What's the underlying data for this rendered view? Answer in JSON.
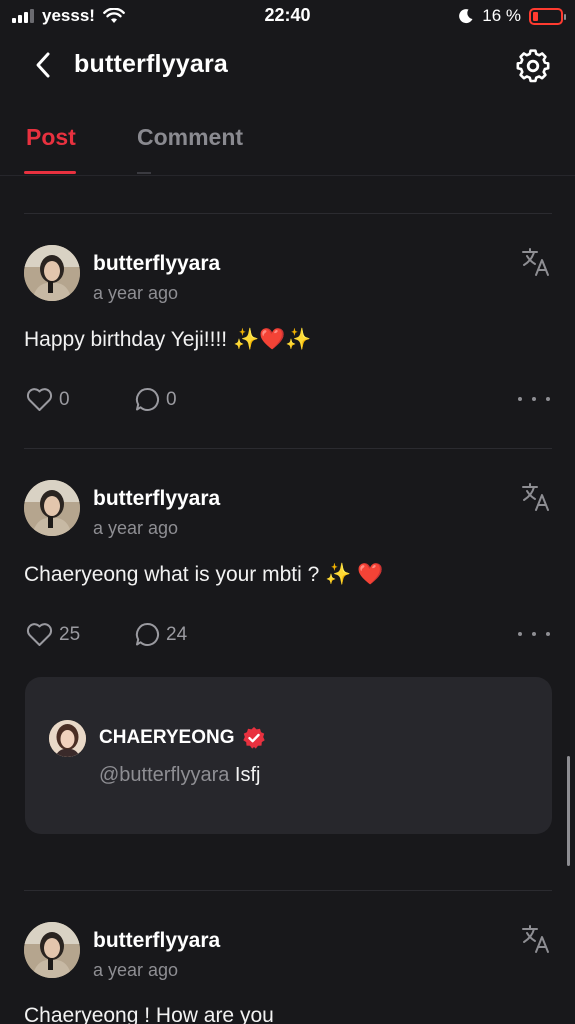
{
  "status_bar": {
    "carrier": "yesss!",
    "time": "22:40",
    "battery_percent": "16 %",
    "signal_icon": "signal-bars-icon",
    "wifi_icon": "wifi-icon",
    "moon_icon": "moon-icon",
    "battery_icon": "battery-low-icon"
  },
  "header": {
    "title": "butterflyyara",
    "back_icon": "chevron-left-icon",
    "settings_icon": "gear-icon"
  },
  "tabs": [
    {
      "label": "Post",
      "active": true
    },
    {
      "label": "Comment",
      "active": false
    }
  ],
  "colors": {
    "accent": "#e8313f",
    "background": "#18181b",
    "card": "#27272c",
    "muted": "#8e8e93"
  },
  "posts": [
    {
      "author": "butterflyyara",
      "time": "a year ago",
      "text": "Happy birthday Yeji!!!! ✨❤️✨",
      "likes": "0",
      "comments": "0"
    },
    {
      "author": "butterflyyara",
      "time": "a year ago",
      "text": "Chaeryeong what is your mbti ? ✨ ❤️",
      "likes": "25",
      "comments": "24",
      "reply": {
        "author": "CHAERYEONG",
        "verified_icon": "verified-badge-icon",
        "mention": "@butterflyyara",
        "text": "Isfj"
      }
    },
    {
      "author": "butterflyyara",
      "time": "a year ago",
      "text": "Chaeryeong ! How are you"
    }
  ]
}
